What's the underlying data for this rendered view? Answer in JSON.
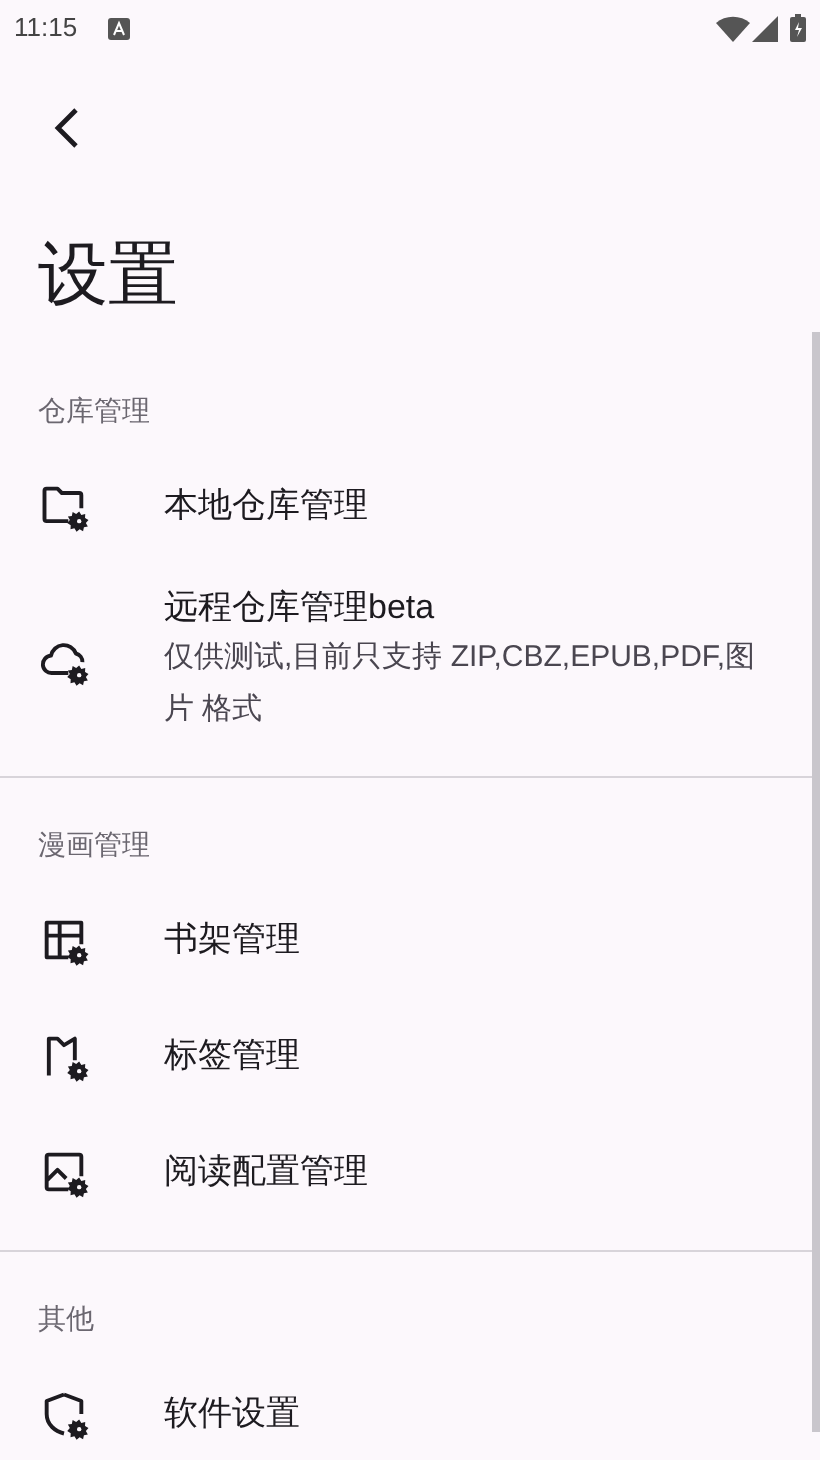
{
  "status_bar": {
    "time": "11:15"
  },
  "title": "设置",
  "sections": [
    {
      "header": "仓库管理",
      "items": [
        {
          "kind": "folder",
          "title": "本地仓库管理"
        },
        {
          "kind": "cloud",
          "title": "远程仓库管理beta",
          "subtitle": "仅供测试,目前只支持 ZIP,CBZ,EPUB,PDF,图片 格式"
        }
      ]
    },
    {
      "header": "漫画管理",
      "items": [
        {
          "kind": "shelf",
          "title": "书架管理"
        },
        {
          "kind": "flag",
          "title": "标签管理"
        },
        {
          "kind": "image",
          "title": "阅读配置管理"
        }
      ]
    },
    {
      "header": "其他",
      "items": [
        {
          "kind": "shield",
          "title": "软件设置"
        }
      ]
    }
  ]
}
